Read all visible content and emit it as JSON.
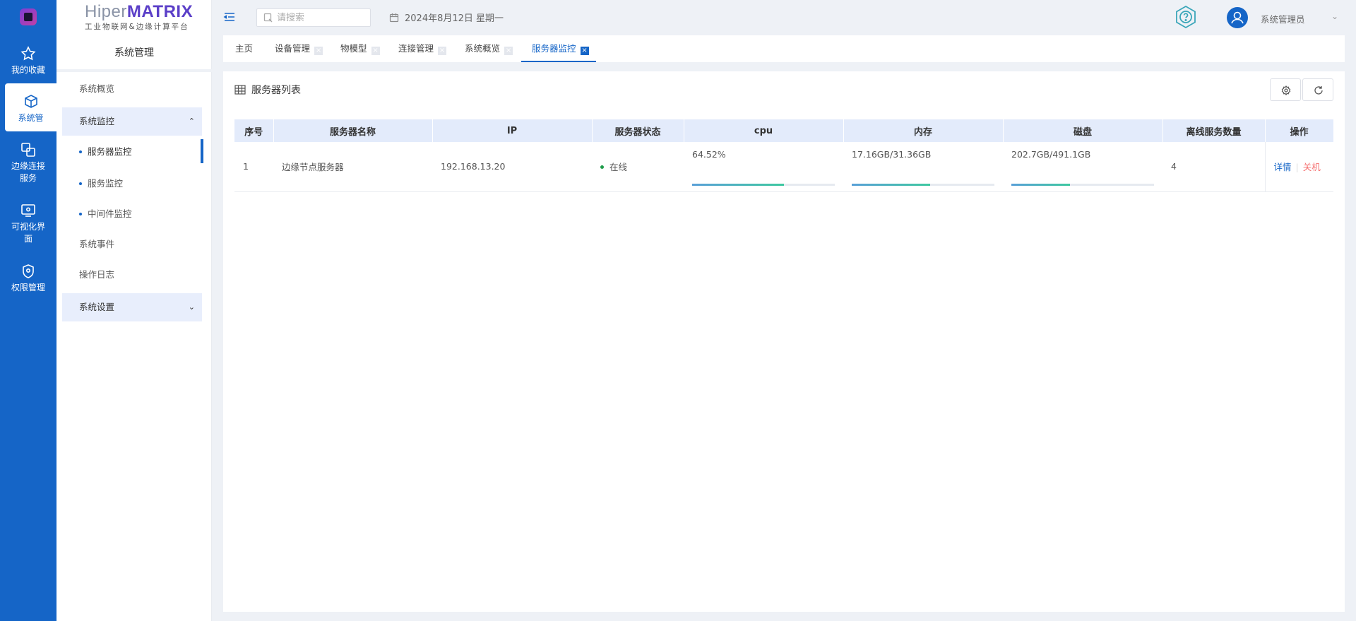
{
  "brand": {
    "name_prefix": "Hiper",
    "name_highlight": "MATRIX",
    "subtitle": "工业物联网&边缘计算平台"
  },
  "rail": {
    "items": [
      {
        "label": "我的收藏",
        "icon": "star-icon"
      },
      {
        "label": "系统管",
        "icon": "cube-icon"
      },
      {
        "label": "边缘连接服务",
        "icon": "link-icon"
      },
      {
        "label": "可视化界面",
        "icon": "eye-screen-icon"
      },
      {
        "label": "权限管理",
        "icon": "shield-icon"
      }
    ]
  },
  "sidebar": {
    "title": "系统管理",
    "items": [
      {
        "label": "系统概览"
      },
      {
        "label": "系统监控"
      },
      {
        "label": "服务器监控"
      },
      {
        "label": "服务监控"
      },
      {
        "label": "中间件监控"
      },
      {
        "label": "系统事件"
      },
      {
        "label": "操作日志"
      },
      {
        "label": "系统设置"
      }
    ]
  },
  "header": {
    "search_placeholder": "请搜索",
    "date": "2024年8月12日 星期一",
    "user_name": "系统管理员"
  },
  "tabs": [
    {
      "label": "主页"
    },
    {
      "label": "设备管理"
    },
    {
      "label": "物模型"
    },
    {
      "label": "连接管理"
    },
    {
      "label": "系统概览"
    },
    {
      "label": "服务器监控"
    }
  ],
  "panel": {
    "title": "服务器列表",
    "columns": [
      "序号",
      "服务器名称",
      "IP",
      "服务器状态",
      "cpu",
      "内存",
      "磁盘",
      "离线服务数量",
      "操作"
    ],
    "rows": [
      {
        "index": "1",
        "name": "边缘节点服务器",
        "ip": "192.168.13.20",
        "status": "在线",
        "cpu": "64.52%",
        "memory": "17.16GB/31.36GB",
        "disk": "202.7GB/491.1GB",
        "offline_count": "4",
        "cpu_level": 0.6452,
        "memory_level": 0.5472,
        "disk_level": 0.4128
      }
    ],
    "actions": {
      "detail": "详情",
      "shutdown": "关机"
    }
  },
  "colors": {
    "primary": "#1565c7",
    "online": "#1e9c4a",
    "danger": "#f56c6c",
    "header_row": "#e3ebfb"
  }
}
